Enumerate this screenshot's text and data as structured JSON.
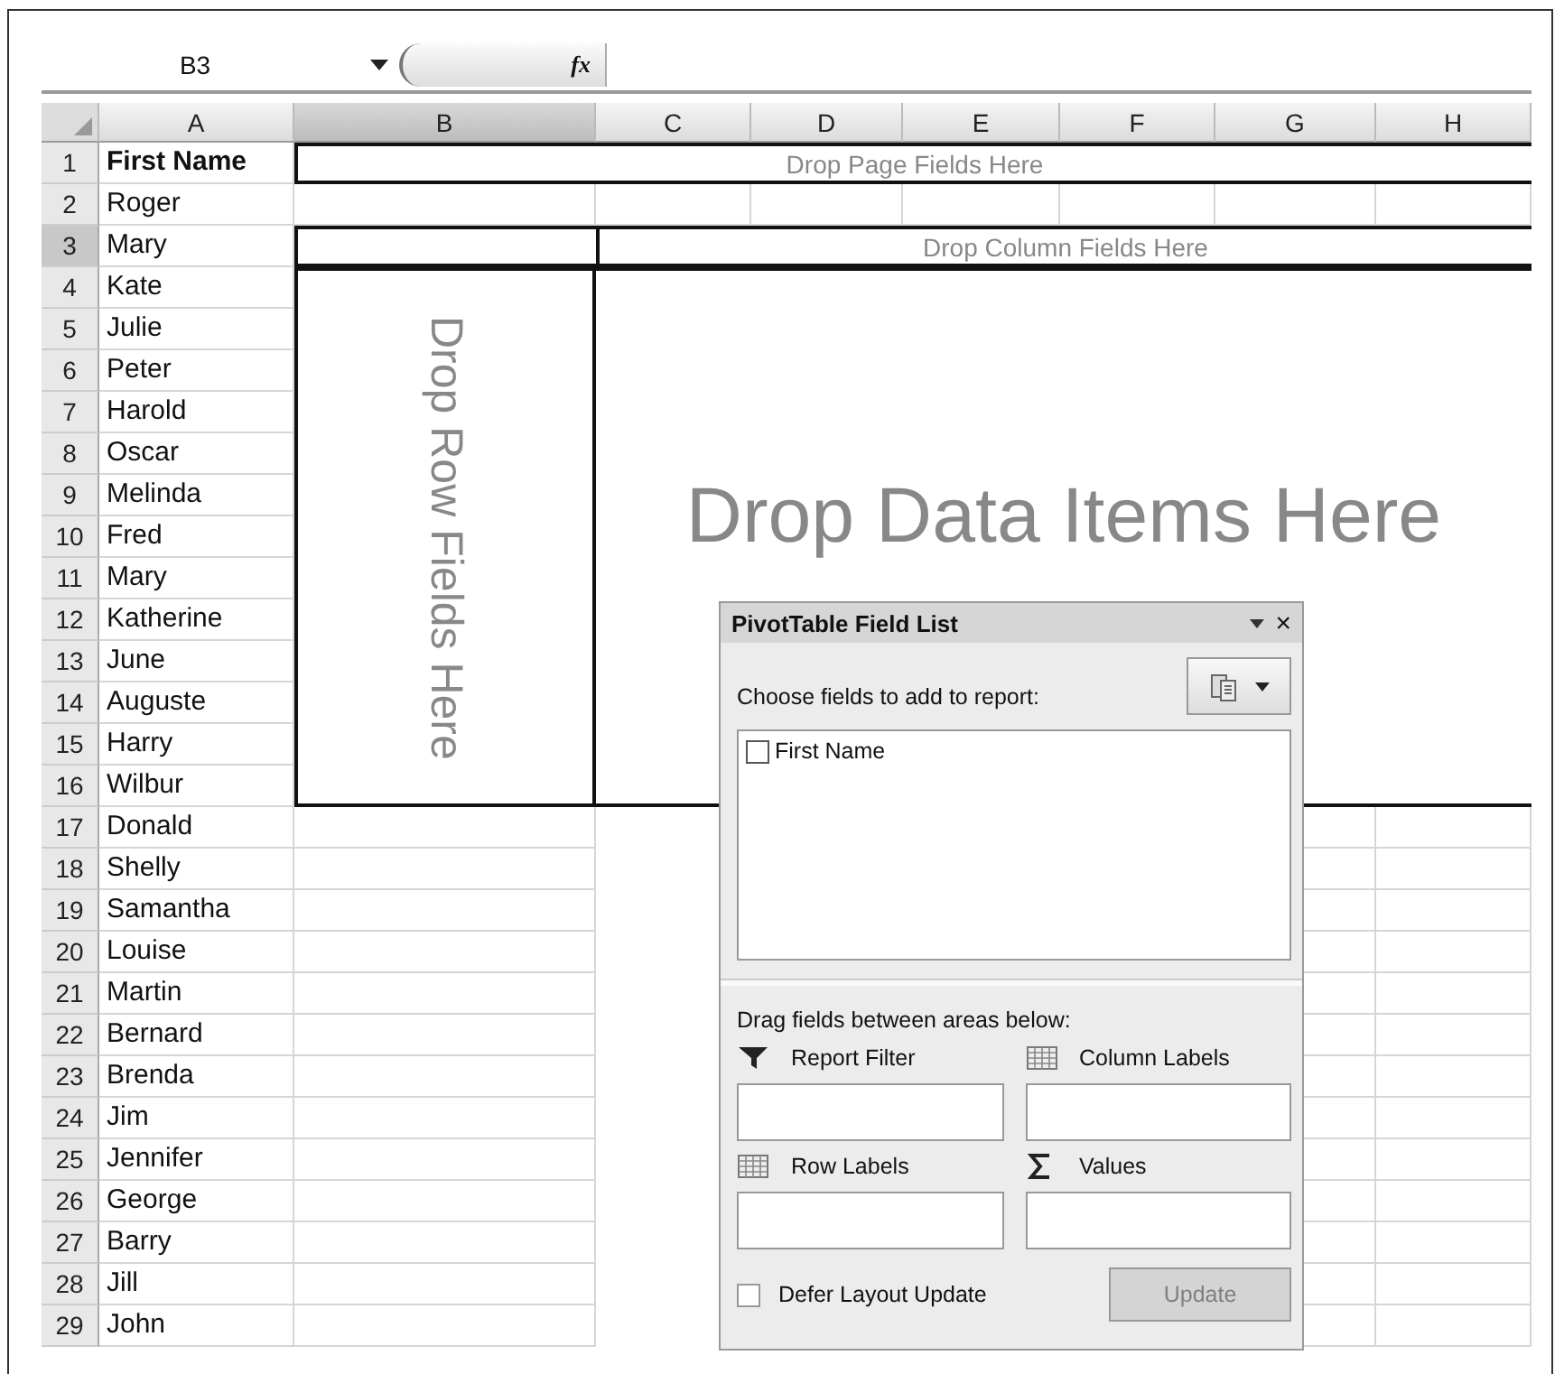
{
  "formula_bar": {
    "name_box": "B3",
    "function_label": "fx"
  },
  "columns": [
    {
      "label": "A",
      "selected": false
    },
    {
      "label": "B",
      "selected": true
    },
    {
      "label": "C",
      "selected": false
    },
    {
      "label": "D",
      "selected": false
    },
    {
      "label": "E",
      "selected": false
    },
    {
      "label": "F",
      "selected": false
    },
    {
      "label": "G",
      "selected": false
    },
    {
      "label": "H",
      "selected": false
    }
  ],
  "rows": [
    {
      "number": "1",
      "name": "First Name",
      "kind": "header",
      "selected": false
    },
    {
      "number": "2",
      "name": "Roger",
      "kind": "data",
      "selected": false
    },
    {
      "number": "3",
      "name": "Mary",
      "kind": "data",
      "selected": true
    },
    {
      "number": "4",
      "name": "Kate",
      "kind": "data",
      "selected": false
    },
    {
      "number": "5",
      "name": "Julie",
      "kind": "data",
      "selected": false
    },
    {
      "number": "6",
      "name": "Peter",
      "kind": "data",
      "selected": false
    },
    {
      "number": "7",
      "name": "Harold",
      "kind": "data",
      "selected": false
    },
    {
      "number": "8",
      "name": "Oscar",
      "kind": "data",
      "selected": false
    },
    {
      "number": "9",
      "name": "Melinda",
      "kind": "data",
      "selected": false
    },
    {
      "number": "10",
      "name": "Fred",
      "kind": "data",
      "selected": false
    },
    {
      "number": "11",
      "name": "Mary",
      "kind": "data",
      "selected": false
    },
    {
      "number": "12",
      "name": "Katherine",
      "kind": "data",
      "selected": false
    },
    {
      "number": "13",
      "name": "June",
      "kind": "data",
      "selected": false
    },
    {
      "number": "14",
      "name": "Auguste",
      "kind": "data",
      "selected": false
    },
    {
      "number": "15",
      "name": "Harry",
      "kind": "data",
      "selected": false
    },
    {
      "number": "16",
      "name": "Wilbur",
      "kind": "data",
      "selected": false
    },
    {
      "number": "17",
      "name": "Donald",
      "kind": "data",
      "selected": false
    },
    {
      "number": "18",
      "name": "Shelly",
      "kind": "data",
      "selected": false
    },
    {
      "number": "19",
      "name": "Samantha",
      "kind": "data",
      "selected": false
    },
    {
      "number": "20",
      "name": "Louise",
      "kind": "data",
      "selected": false
    },
    {
      "number": "21",
      "name": "Martin",
      "kind": "data",
      "selected": false
    },
    {
      "number": "22",
      "name": "Bernard",
      "kind": "data",
      "selected": false
    },
    {
      "number": "23",
      "name": "Brenda",
      "kind": "data",
      "selected": false
    },
    {
      "number": "24",
      "name": "Jim",
      "kind": "data",
      "selected": false
    },
    {
      "number": "25",
      "name": "Jennifer",
      "kind": "data",
      "selected": false
    },
    {
      "number": "26",
      "name": "George",
      "kind": "data",
      "selected": false
    },
    {
      "number": "27",
      "name": "Barry",
      "kind": "data",
      "selected": false
    },
    {
      "number": "28",
      "name": "Jill",
      "kind": "data",
      "selected": false
    },
    {
      "number": "29",
      "name": "John",
      "kind": "data",
      "selected": false
    }
  ],
  "pivot_areas": {
    "page_fields": "Drop Page Fields Here",
    "column_fields": "Drop Column Fields Here",
    "row_fields": "Drop Row Fields Here",
    "data_items": "Drop Data Items Here"
  },
  "field_list": {
    "title": "PivotTable Field List",
    "close": "×",
    "prompt": "Choose fields to add to report:",
    "fields": [
      {
        "label": "First Name",
        "checked": false
      }
    ],
    "areas_prompt": "Drag fields between areas below:",
    "areas": [
      {
        "label": "Report Filter",
        "kind": "filter"
      },
      {
        "label": "Column Labels",
        "kind": "columns"
      },
      {
        "label": "Row Labels",
        "kind": "rows"
      },
      {
        "label": "Values",
        "kind": "values"
      }
    ],
    "defer_update": {
      "label": "Defer Layout Update",
      "checked": false
    },
    "update_button": {
      "label": "Update",
      "disabled": true
    }
  }
}
